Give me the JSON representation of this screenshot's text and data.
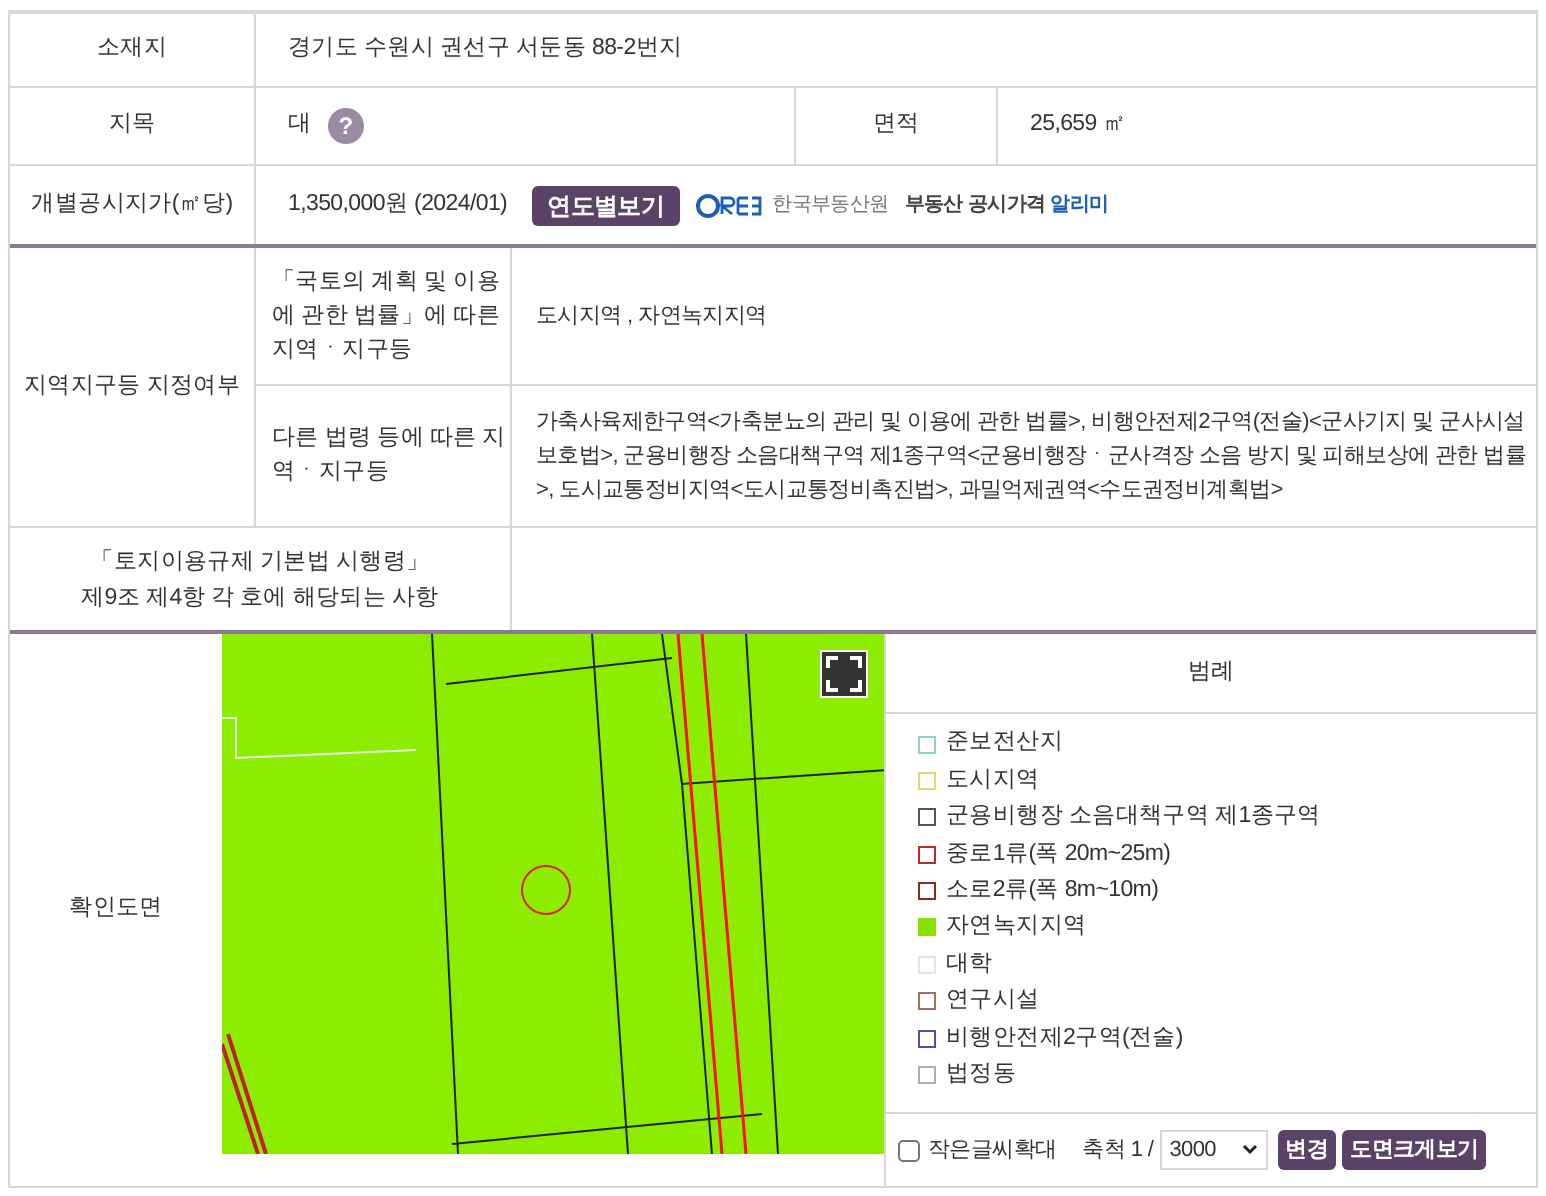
{
  "location": {
    "label": "소재지",
    "value": "경기도 수원시 권선구 서둔동 88-2번지"
  },
  "land_category": {
    "label": "지목",
    "value": "대",
    "help": "?"
  },
  "area": {
    "label": "면적",
    "value": "25,659 ㎡"
  },
  "price": {
    "label": "개별공시지가(㎡당)",
    "value": "1,350,000원 (2024/01)",
    "button": "연도별보기",
    "provider": "한국부동산원",
    "service": "부동산 공시가격",
    "service_highlight": "알리미"
  },
  "zoning": {
    "label": "지역지구등 지정여부",
    "rows": [
      {
        "label": "「국토의 계획 및 이용에 관한 법률」에 따른 지역ㆍ지구등",
        "value": "도시지역 , 자연녹지지역"
      },
      {
        "label": "다른 법령 등에 따른 지역ㆍ지구등",
        "value": "가축사육제한구역<가축분뇨의 관리 및 이용에 관한 법률>, 비행안전제2구역(전술)<군사기지 및 군사시설 보호법>, 군용비행장 소음대책구역 제1종구역<군용비행장ㆍ군사격장 소음 방지 및 피해보상에 관한 법률>, 도시교통정비지역<도시교통정비촉진법>, 과밀억제권역<수도권정비계획법>"
      }
    ]
  },
  "regulation": {
    "label_line1": "「토지이용규제 기본법 시행령」",
    "label_line2": "제9조 제4항 각 호에 해당되는 사항"
  },
  "map": {
    "label": "확인도면",
    "legend_title": "범례",
    "legend": [
      {
        "name": "준보전산지",
        "color": "#8fd3c8",
        "kind": "outline"
      },
      {
        "name": "도시지역",
        "color": "#e0d870",
        "kind": "outline"
      },
      {
        "name": "군용비행장 소음대책구역 제1종구역",
        "color": "#555555",
        "kind": "outline"
      },
      {
        "name": "중로1류(폭 20m~25m)",
        "color": "#b03030",
        "kind": "outline"
      },
      {
        "name": "소로2류(폭 8m~10m)",
        "color": "#902828",
        "kind": "outline"
      },
      {
        "name": "자연녹지지역",
        "color": "#88e000",
        "kind": "filled"
      },
      {
        "name": "대학",
        "color": "#dfe8df",
        "kind": "outline"
      },
      {
        "name": "연구시설",
        "color": "#a07060",
        "kind": "outline"
      },
      {
        "name": "비행안전제2구역(전술)",
        "color": "#5050a0",
        "kind": "outline"
      },
      {
        "name": "법정동",
        "color": "#b8a8a8",
        "kind": "outline"
      }
    ],
    "enlarge_text": {
      "label": "작은글씨확대",
      "checked": false
    },
    "scale_label": "축척 1 /",
    "scale_value": "3000",
    "change_button": "변경",
    "large_view_button": "도면크게보기"
  }
}
